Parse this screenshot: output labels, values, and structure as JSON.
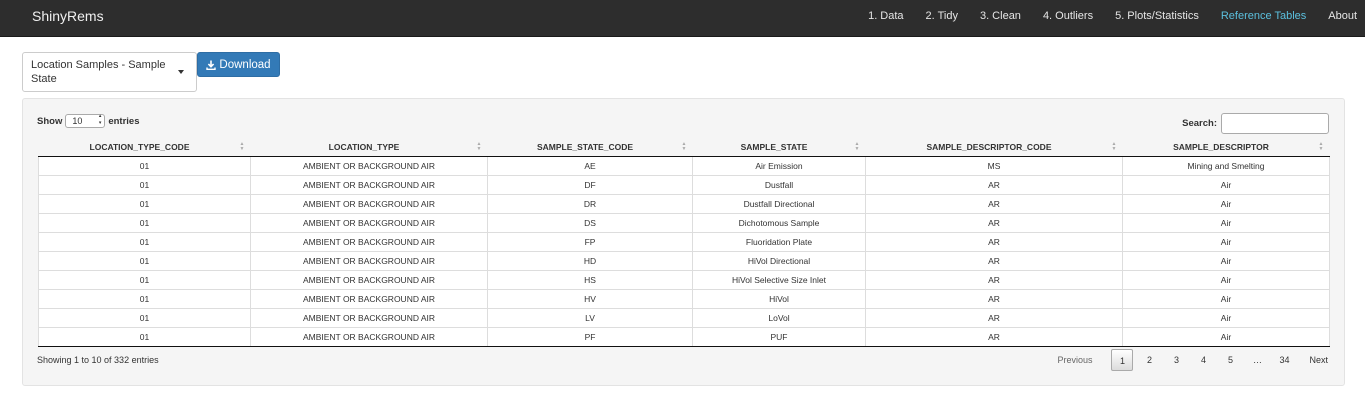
{
  "app": {
    "brand": "ShinyRems"
  },
  "nav": {
    "items": [
      {
        "label": "1. Data"
      },
      {
        "label": "2. Tidy"
      },
      {
        "label": "3. Clean"
      },
      {
        "label": "4. Outliers"
      },
      {
        "label": "5. Plots/Statistics"
      },
      {
        "label": "Reference Tables",
        "active": true
      },
      {
        "label": "About"
      }
    ]
  },
  "controls": {
    "table_select": "Location Samples - Sample State",
    "download_label": "Download"
  },
  "table": {
    "show_label": "Show",
    "entries_label": "entries",
    "page_length": "10",
    "search_label": "Search:",
    "search_value": "",
    "columns": [
      "LOCATION_TYPE_CODE",
      "LOCATION_TYPE",
      "SAMPLE_STATE_CODE",
      "SAMPLE_STATE",
      "SAMPLE_DESCRIPTOR_CODE",
      "SAMPLE_DESCRIPTOR"
    ],
    "rows": [
      [
        "01",
        "AMBIENT OR BACKGROUND AIR",
        "AE",
        "Air Emission",
        "MS",
        "Mining and Smelting"
      ],
      [
        "01",
        "AMBIENT OR BACKGROUND AIR",
        "DF",
        "Dustfall",
        "AR",
        "Air"
      ],
      [
        "01",
        "AMBIENT OR BACKGROUND AIR",
        "DR",
        "Dustfall Directional",
        "AR",
        "Air"
      ],
      [
        "01",
        "AMBIENT OR BACKGROUND AIR",
        "DS",
        "Dichotomous Sample",
        "AR",
        "Air"
      ],
      [
        "01",
        "AMBIENT OR BACKGROUND AIR",
        "FP",
        "Fluoridation Plate",
        "AR",
        "Air"
      ],
      [
        "01",
        "AMBIENT OR BACKGROUND AIR",
        "HD",
        "HiVol Directional",
        "AR",
        "Air"
      ],
      [
        "01",
        "AMBIENT OR BACKGROUND AIR",
        "HS",
        "HiVol Selective Size Inlet",
        "AR",
        "Air"
      ],
      [
        "01",
        "AMBIENT OR BACKGROUND AIR",
        "HV",
        "HiVol",
        "AR",
        "Air"
      ],
      [
        "01",
        "AMBIENT OR BACKGROUND AIR",
        "LV",
        "LoVol",
        "AR",
        "Air"
      ],
      [
        "01",
        "AMBIENT OR BACKGROUND AIR",
        "PF",
        "PUF",
        "AR",
        "Air"
      ]
    ],
    "info": "Showing 1 to 10 of 332 entries"
  },
  "pagination": {
    "previous": "Previous",
    "pages": [
      "1",
      "2",
      "3",
      "4",
      "5",
      "…",
      "34"
    ],
    "current": "1",
    "next": "Next"
  },
  "colors": {
    "navbar": "#2d2d2d",
    "active_nav": "#5bc0de",
    "button": "#337ab7"
  }
}
